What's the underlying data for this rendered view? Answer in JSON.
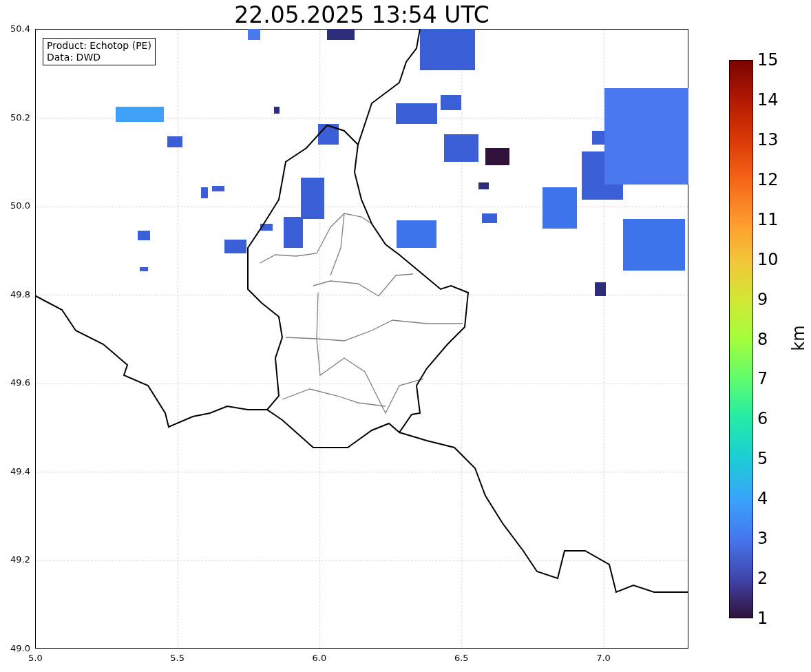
{
  "title": "22.05.2025 13:54 UTC",
  "info_box": {
    "lines": [
      "Product: Echotop (PE)",
      "Data: DWD"
    ]
  },
  "map": {
    "xticks": [
      "5.0",
      "5.5",
      "6.0",
      "6.5",
      "7.0"
    ],
    "yticks": [
      "50.4",
      "50.2",
      "50.0",
      "49.8",
      "49.6",
      "49.4",
      "49.2",
      "49.0"
    ]
  },
  "colorbar": {
    "ticks": [
      "15",
      "14",
      "13",
      "12",
      "11",
      "10",
      "9",
      "8",
      "7",
      "6",
      "5",
      "4",
      "3",
      "2",
      "1"
    ],
    "label": "km"
  }
}
